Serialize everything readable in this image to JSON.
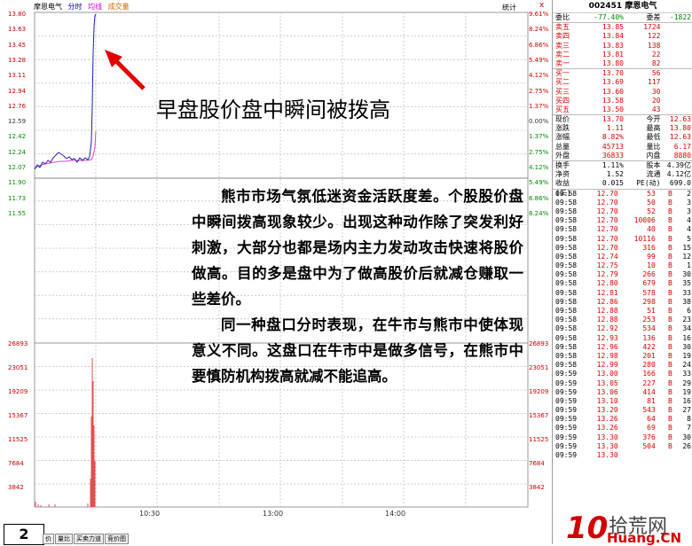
{
  "chart": {
    "stock_name": "摩恩电气",
    "tab_intraday": "分时",
    "tab_avg": "均线",
    "tab_volume": "成交量",
    "stat_button": "统计",
    "close_icon": "x",
    "price_labels": [
      "13.80",
      "13.63",
      "13.45",
      "13.28",
      "13.11",
      "12.94",
      "12.76",
      "12.59",
      "12.42",
      "12.24",
      "12.07",
      "11.90",
      "11.73",
      "11.55"
    ],
    "pct_labels": [
      "9.61%",
      "8.24%",
      "6.86%",
      "5.49%",
      "4.12%",
      "2.75%",
      "1.37%",
      "0.00%",
      "1.37%",
      "2.75%",
      "4.12%",
      "5.49%",
      "6.86%",
      "8.24%"
    ],
    "vol_labels": [
      "26893",
      "23051",
      "19209",
      "15367",
      "11525",
      "7684",
      "3842"
    ],
    "time_labels": [
      "10:30",
      "13:00",
      "14:00"
    ],
    "bottom_tabs": [
      "量比",
      "买卖力道",
      "竞价图"
    ],
    "bottom_tab_prefix": "价",
    "annotation_title": "早盘股价盘中瞬间被拨高",
    "annotation_para1": "熊市市场气氛低迷资金活跃度差。个股股价盘中瞬间拨高现象较少。出现这种动作除了突发利好刺激，大部分也都是场内主力发动攻击快速将股价做高。目的多是盘中为了做高股价后就减仓赚取一些差价。",
    "annotation_para2": "同一种盘口分时表现，在牛市与熊市中使体现意义不同。这盘口在牛市中是做多信号，在熊市中要慎防机构拨高就减不能追高。",
    "page_number": "2",
    "colors": {
      "price_line": "#2020b0",
      "avg_line": "#e040c0",
      "volume_bar": "#e05050",
      "up": "#d00000",
      "down": "#008000"
    }
  },
  "quote": {
    "code": "002451",
    "name": "摩恩电气",
    "wei_bi_label": "委比",
    "wei_bi_value": "-77.40%",
    "wei_cha_label": "委差",
    "wei_cha_value": "-1822",
    "asks": [
      {
        "label": "卖五",
        "price": "13.85",
        "vol": "1724"
      },
      {
        "label": "卖四",
        "price": "13.84",
        "vol": "122"
      },
      {
        "label": "卖三",
        "price": "13.83",
        "vol": "138"
      },
      {
        "label": "卖二",
        "price": "13.81",
        "vol": "22"
      },
      {
        "label": "卖一",
        "price": "13.80",
        "vol": "82"
      }
    ],
    "bids": [
      {
        "label": "买一",
        "price": "13.70",
        "vol": "56"
      },
      {
        "label": "买二",
        "price": "13.69",
        "vol": "117"
      },
      {
        "label": "买三",
        "price": "13.60",
        "vol": "30"
      },
      {
        "label": "买四",
        "price": "13.58",
        "vol": "20"
      },
      {
        "label": "买五",
        "price": "13.50",
        "vol": "43"
      }
    ],
    "stats": [
      {
        "l1": "现价",
        "v1": "13.70",
        "l2": "今开",
        "v2": "12.63"
      },
      {
        "l1": "涨跌",
        "v1": "1.11",
        "l2": "最高",
        "v2": "13.80"
      },
      {
        "l1": "涨幅",
        "v1": "8.82%",
        "l2": "最低",
        "v2": "12.63"
      },
      {
        "l1": "总量",
        "v1": "45713",
        "l2": "量比",
        "v2": "6.17"
      },
      {
        "l1": "外盘",
        "v1": "36833",
        "l2": "内盘",
        "v2": "8880"
      }
    ],
    "stats2": [
      {
        "l1": "换手",
        "v1": "1.11%",
        "l2": "股本",
        "v2": "4.39亿"
      },
      {
        "l1": "净资",
        "v1": "1.52",
        "l2": "流通",
        "v2": "4.12亿"
      },
      {
        "l1": "收益(三)",
        "v1": "0.015",
        "l2": "PE(动)",
        "v2": "699.0"
      }
    ],
    "trades": [
      {
        "t": "09:58",
        "p": "12.70",
        "v": "53",
        "f": "B",
        "n": "2"
      },
      {
        "t": "09:58",
        "p": "12.70",
        "v": "50",
        "f": "B",
        "n": "3"
      },
      {
        "t": "09:58",
        "p": "12.70",
        "v": "52",
        "f": "B",
        "n": "3"
      },
      {
        "t": "09:58",
        "p": "12.70",
        "v": "10006",
        "f": "B",
        "n": "4"
      },
      {
        "t": "09:58",
        "p": "12.70",
        "v": "40",
        "f": "B",
        "n": "4"
      },
      {
        "t": "09:58",
        "p": "12.70",
        "v": "10116",
        "f": "B",
        "n": "5"
      },
      {
        "t": "09:58",
        "p": "12.70",
        "v": "316",
        "f": "B",
        "n": "15"
      },
      {
        "t": "09:58",
        "p": "12.74",
        "v": "99",
        "f": "B",
        "n": "12"
      },
      {
        "t": "09:58",
        "p": "12.75",
        "v": "10",
        "f": "B",
        "n": "1"
      },
      {
        "t": "09:58",
        "p": "12.79",
        "v": "266",
        "f": "B",
        "n": "30"
      },
      {
        "t": "09:58",
        "p": "12.80",
        "v": "679",
        "f": "B",
        "n": "35"
      },
      {
        "t": "09:58",
        "p": "12.81",
        "v": "578",
        "f": "B",
        "n": "33"
      },
      {
        "t": "09:58",
        "p": "12.86",
        "v": "298",
        "f": "B",
        "n": "38"
      },
      {
        "t": "09:58",
        "p": "12.88",
        "v": "51",
        "f": "B",
        "n": "6"
      },
      {
        "t": "09:58",
        "p": "12.88",
        "v": "253",
        "f": "B",
        "n": "23"
      },
      {
        "t": "09:58",
        "p": "12.92",
        "v": "534",
        "f": "B",
        "n": "34"
      },
      {
        "t": "09:58",
        "p": "12.93",
        "v": "136",
        "f": "B",
        "n": "16"
      },
      {
        "t": "09:58",
        "p": "12.96",
        "v": "422",
        "f": "B",
        "n": "30"
      },
      {
        "t": "09:58",
        "p": "12.98",
        "v": "201",
        "f": "B",
        "n": "19"
      },
      {
        "t": "09:58",
        "p": "12.99",
        "v": "280",
        "f": "B",
        "n": "24"
      },
      {
        "t": "09:59",
        "p": "13.00",
        "v": "166",
        "f": "B",
        "n": "33"
      },
      {
        "t": "09:59",
        "p": "13.05",
        "v": "227",
        "f": "B",
        "n": "29"
      },
      {
        "t": "09:59",
        "p": "13.06",
        "v": "414",
        "f": "B",
        "n": "19"
      },
      {
        "t": "09:59",
        "p": "13.10",
        "v": "81",
        "f": "B",
        "n": "16"
      },
      {
        "t": "09:59",
        "p": "13.20",
        "v": "543",
        "f": "B",
        "n": "27"
      },
      {
        "t": "09:59",
        "p": "13.26",
        "v": "64",
        "f": "B",
        "n": "8"
      },
      {
        "t": "09:59",
        "p": "13.26",
        "v": "69",
        "f": "B",
        "n": "7"
      },
      {
        "t": "09:59",
        "p": "13.30",
        "v": "376",
        "f": "B",
        "n": "30"
      },
      {
        "t": "09:59",
        "p": "13.30",
        "v": "504",
        "f": "B",
        "n": "26"
      },
      {
        "t": "09:59",
        "p": "13.30",
        "v": "",
        "f": "",
        "n": ""
      }
    ],
    "logo_cn": "拾荒网",
    "logo_en": "Huang.CN",
    "logo_num": "10"
  }
}
